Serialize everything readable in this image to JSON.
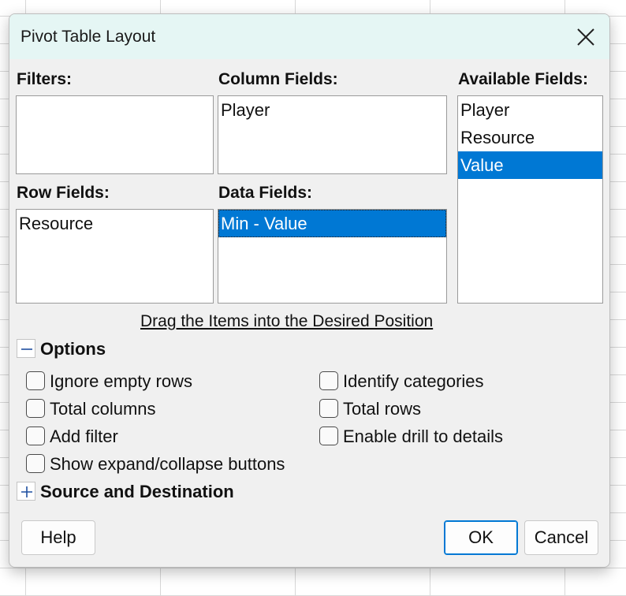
{
  "dialog": {
    "title": "Pivot Table Layout",
    "close_icon": "close-icon"
  },
  "filters": {
    "label": "Filters:",
    "items": []
  },
  "column_fields": {
    "label": "Column Fields:",
    "items": [
      "Player"
    ]
  },
  "row_fields": {
    "label": "Row Fields:",
    "items": [
      "Resource"
    ]
  },
  "data_fields": {
    "label": "Data Fields:",
    "items": [
      "Min - Value"
    ],
    "selected_index": 0
  },
  "available_fields": {
    "label": "Available Fields:",
    "items": [
      "Player",
      "Resource",
      "Value"
    ],
    "selected_index": 2
  },
  "hint": "Drag the Items into the Desired Position",
  "options": {
    "label": "Options",
    "expanded": true,
    "toggle_icon": "minus-icon",
    "checkboxes": [
      {
        "label": "Ignore empty rows",
        "checked": false
      },
      {
        "label": "Identify categories",
        "checked": false
      },
      {
        "label": "Total columns",
        "checked": false
      },
      {
        "label": "Total rows",
        "checked": false
      },
      {
        "label": "Add filter",
        "checked": false
      },
      {
        "label": "Enable drill to details",
        "checked": false
      },
      {
        "label": "Show expand/collapse buttons",
        "checked": false
      }
    ]
  },
  "source_destination": {
    "label": "Source and Destination",
    "expanded": false,
    "toggle_icon": "plus-icon"
  },
  "buttons": {
    "help": "Help",
    "ok": "OK",
    "cancel": "Cancel"
  },
  "colors": {
    "accent": "#0078d4",
    "title_bar": "#e5f6f4",
    "dialog_bg": "#f0f0f0"
  }
}
